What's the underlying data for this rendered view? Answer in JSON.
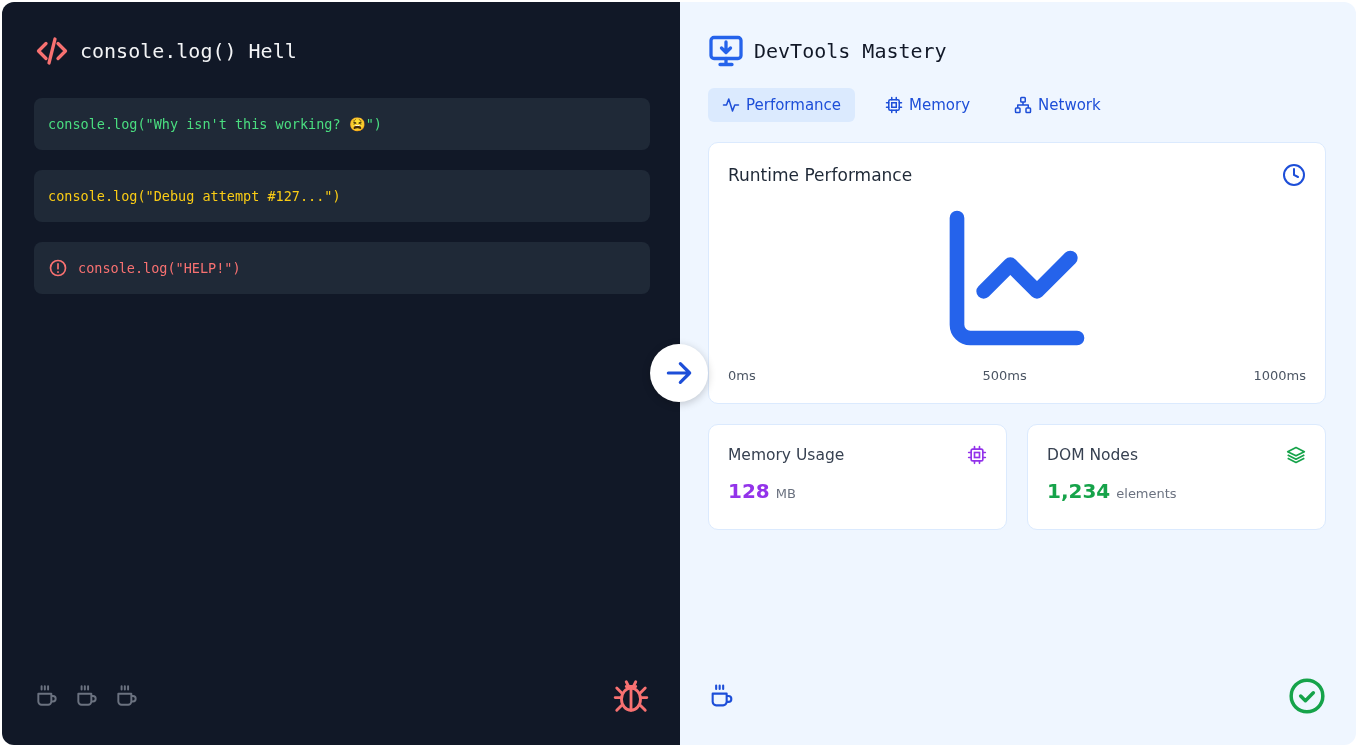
{
  "left_panel": {
    "title": "console.log() Hell",
    "logs": [
      {
        "kind": "success",
        "text": "console.log(\"Why isn't this working? 😫\")"
      },
      {
        "kind": "warning",
        "text": "console.log(\"Debug attempt #127...\")"
      },
      {
        "kind": "error",
        "text": "console.log(\"HELP!\")"
      }
    ]
  },
  "right_panel": {
    "title": "DevTools Mastery",
    "tabs": [
      {
        "label": "Performance",
        "selected": true
      },
      {
        "label": "Memory",
        "selected": false
      },
      {
        "label": "Network",
        "selected": false
      }
    ],
    "performance_card": {
      "title": "Runtime Performance",
      "axis_labels": [
        "0ms",
        "500ms",
        "1000ms"
      ]
    },
    "metrics": [
      {
        "title": "Memory Usage",
        "value": "128",
        "unit": "MB",
        "color": "#9333ea"
      },
      {
        "title": "DOM Nodes",
        "value": "1,234",
        "unit": "elements",
        "color": "#16a34a"
      }
    ]
  }
}
